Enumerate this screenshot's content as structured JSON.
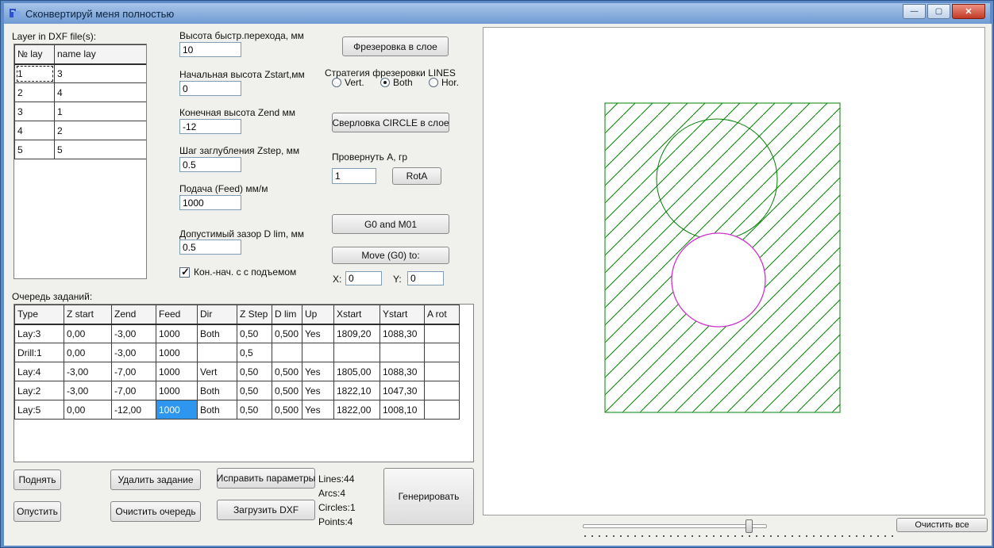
{
  "window": {
    "title": "Сконвертируй меня полностью",
    "icons": {
      "minimize": "—",
      "maximize": "▢",
      "close": "✕"
    }
  },
  "layers_panel": {
    "label": "Layer in DXF file(s):",
    "columns": [
      "№ lay",
      "name lay"
    ],
    "rows": [
      [
        "1",
        "3"
      ],
      [
        "2",
        "4"
      ],
      [
        "3",
        "1"
      ],
      [
        "4",
        "2"
      ],
      [
        "5",
        "5"
      ]
    ],
    "focused_cell": {
      "row": 0,
      "col": 0
    }
  },
  "params": {
    "fields": [
      {
        "label": "Высота быстр.перехода, мм",
        "value": "10"
      },
      {
        "label": "Начальная высота Zstart,мм",
        "value": "0"
      },
      {
        "label": "Конечная высота Zend мм",
        "value": "-12"
      },
      {
        "label": "Шаг заглубления Zstep, мм",
        "value": "0.5"
      },
      {
        "label": "Подача (Feed) мм/м",
        "value": "1000"
      },
      {
        "label": "Допустимый зазор D lim, мм",
        "value": "0.5"
      }
    ],
    "lift_checkbox": {
      "label": "Кон.-нач. с  с подъемом",
      "checked": true
    }
  },
  "actions": {
    "mill_button": "Фрезеровка в слое",
    "strategy_label": "Стратегия фрезеровки LINES",
    "strategy_options": [
      {
        "label": "Vert.",
        "selected": false
      },
      {
        "label": "Both",
        "selected": true
      },
      {
        "label": "Hor.",
        "selected": false
      }
    ],
    "drill_button": "Сверловка CIRCLE в слое",
    "rotate_label": "Провернуть A, гр",
    "rotate_value": "1",
    "rotate_button": "RotA",
    "g0m01_button": "G0 and M01",
    "move_button": "Move (G0) to:",
    "x_label": "X:",
    "x_value": "0",
    "y_label": "Y:",
    "y_value": "0"
  },
  "queue": {
    "label": "Очередь заданий:",
    "columns": [
      "Type",
      "Z start",
      "Zend",
      "Feed",
      "Dir",
      "Z Step",
      "D lim",
      "Up",
      "Xstart",
      "Ystart",
      "A rot"
    ],
    "rows": [
      [
        "Lay:3",
        "0,00",
        "-3,00",
        "1000",
        "Both",
        "0,50",
        "0,500",
        "Yes",
        "1809,20",
        "1088,30",
        ""
      ],
      [
        "Drill:1",
        "0,00",
        "-3,00",
        "1000",
        "",
        "0,5",
        "",
        "",
        "",
        "",
        ""
      ],
      [
        "Lay:4",
        "-3,00",
        "-7,00",
        "1000",
        "Vert",
        "0,50",
        "0,500",
        "Yes",
        "1805,00",
        "1088,30",
        ""
      ],
      [
        "Lay:2",
        "-3,00",
        "-7,00",
        "1000",
        "Both",
        "0,50",
        "0,500",
        "Yes",
        "1822,10",
        "1047,30",
        ""
      ],
      [
        "Lay:5",
        "0,00",
        "-12,00",
        "1000",
        "Both",
        "0,50",
        "0,500",
        "Yes",
        "1822,00",
        "1008,10",
        ""
      ]
    ],
    "selected_cell": {
      "row": 4,
      "col": 3
    }
  },
  "bottom": {
    "raise_button": "Поднять",
    "lower_button": "Опустить",
    "delete_button": "Удалить задание",
    "clear_queue_button": "Очистить очередь",
    "fix_params_button": "Исправить параметры",
    "load_dxf_button": "Загрузить DXF",
    "stats": [
      "Lines:44",
      "Arcs:4",
      "Circles:1",
      "Points:4"
    ],
    "generate_button": "Генерировать"
  },
  "viewer": {
    "clear_all_button": "Очистить все",
    "colors": {
      "hatch_outline": "#008000",
      "hole_circle": "#cc33cc"
    }
  }
}
